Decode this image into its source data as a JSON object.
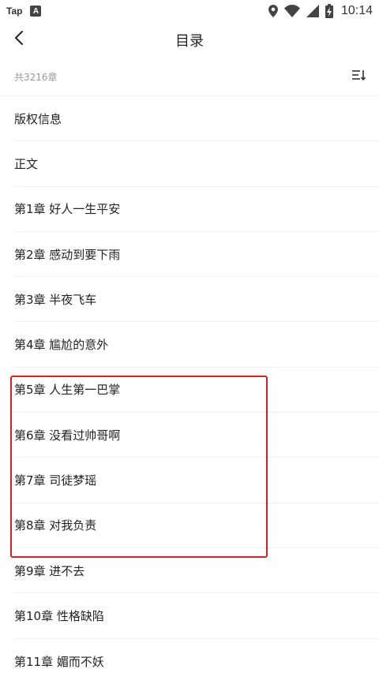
{
  "status_bar": {
    "carrier_label": "Tap",
    "badge_letter": "A",
    "time": "10:14",
    "icons": [
      "location-icon",
      "wifi-icon",
      "signal-icon",
      "battery-charging-icon"
    ]
  },
  "header": {
    "title": "目录",
    "back_icon": "chevron-left-icon"
  },
  "summary": {
    "chapter_count": "共3216章",
    "sort_icon": "sort-order-icon"
  },
  "chapters": [
    {
      "title": "版权信息"
    },
    {
      "title": "正文"
    },
    {
      "title": "第1章 好人一生平安"
    },
    {
      "title": "第2章 感动到要下雨"
    },
    {
      "title": "第3章 半夜飞车"
    },
    {
      "title": "第4章 尴尬的意外"
    },
    {
      "title": "第5章 人生第一巴掌"
    },
    {
      "title": "第6章 没看过帅哥啊"
    },
    {
      "title": "第7章 司徒梦瑶"
    },
    {
      "title": "第8章 对我负责"
    },
    {
      "title": "第9章 进不去"
    },
    {
      "title": "第10章 性格缺陷"
    },
    {
      "title": "第11章 媚而不妖"
    }
  ],
  "colors": {
    "highlight": "#e02020",
    "text": "#222222",
    "muted": "#9a9a9a",
    "divider": "#f0f0f0"
  }
}
